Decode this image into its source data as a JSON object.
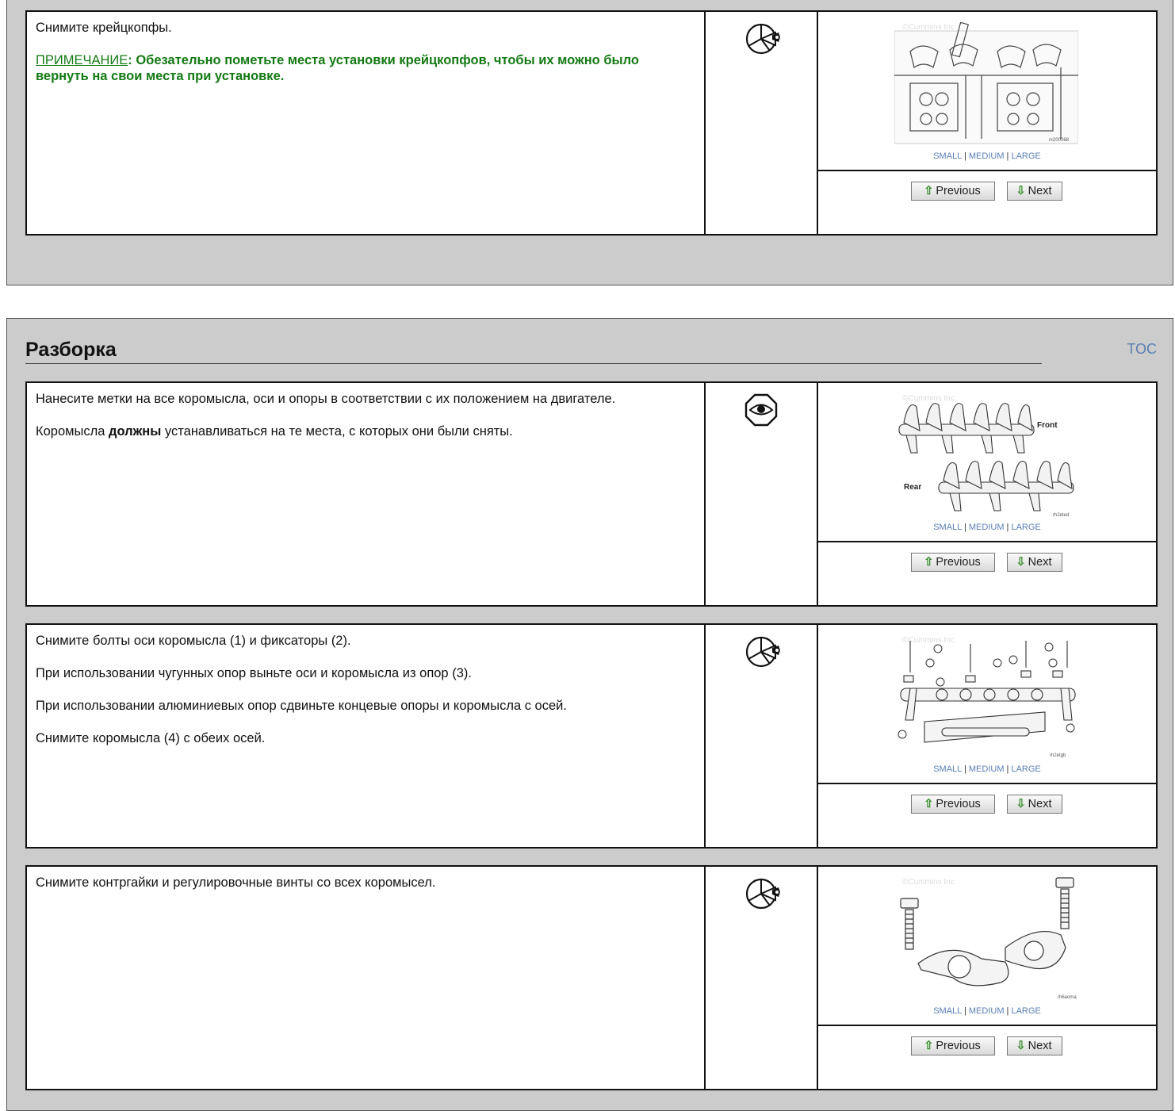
{
  "top_step": {
    "text": "Снимите крейцкопфы.",
    "note_label": "ПРИМЕЧАНИЕ",
    "note_text": ": Обезательно пометьте места установки крейцкопфов, чтобы их можно было вернуть на свои места при установке.",
    "icon": "wrench-pie-icon",
    "watermark": "©Cummins Inc",
    "figure_code": "rx200068"
  },
  "section": {
    "title": "Разборка",
    "toc_label": "TOC"
  },
  "steps": [
    {
      "p1": "Нанесите метки на все коромысла, оси и опоры в соответствии с их положением на двигателе.",
      "p2_before": "Коромысла ",
      "p2_bold": "должны",
      "p2_after": " устанавливаться на те места, с которых они были сняты.",
      "icon": "eye-icon",
      "fig_labels": {
        "front": "Front",
        "rear": "Rear",
        "code": "rh2eted"
      },
      "watermark": "©Cummins Inc"
    },
    {
      "lines": [
        "Снимите болты оси коромысла (1) и фиксаторы (2).",
        "При использовании чугунных опор выньте оси и коромысла из опор (3).",
        "При использовании алюминиевых опор сдвиньте концевые опоры и коромысла с осей.",
        "Снимите коромысла (4) с обеих осей."
      ],
      "icon": "wrench-pie-icon",
      "fig_labels": {
        "code": "rh2etgb"
      },
      "watermark": "©Cummins Inc"
    },
    {
      "text": "Снимите контргайки и регулировочные винты со всех коромысел.",
      "icon": "wrench-pie-icon",
      "fig_labels": {
        "code": "rh6aoma"
      },
      "watermark": "©Cummins Inc"
    }
  ],
  "size_links": {
    "small": "SMALL",
    "medium": "MEDIUM",
    "large": "LARGE",
    "sep": "|"
  },
  "nav": {
    "previous": "Previous",
    "next": "Next"
  },
  "colors": {
    "panel": "#cccccc",
    "link": "#5a7fb4",
    "note": "#137a13",
    "arrow": "#3a8f2e"
  }
}
